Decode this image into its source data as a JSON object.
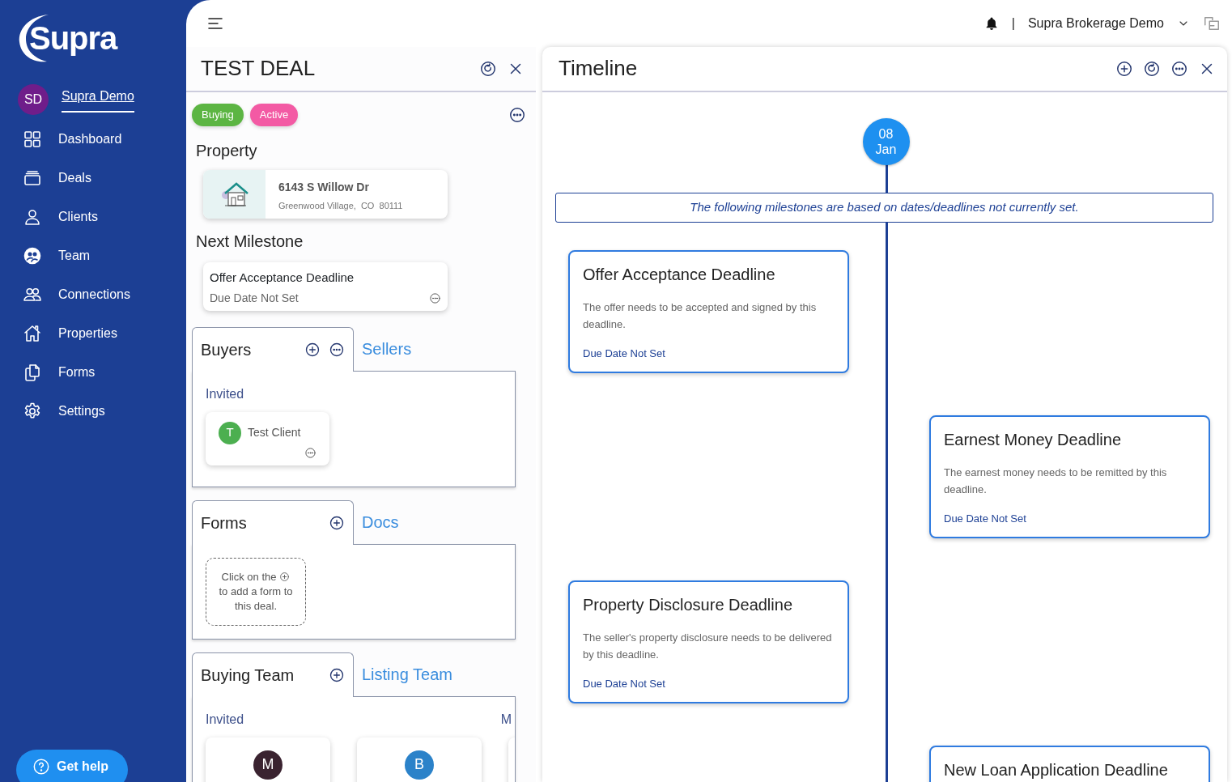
{
  "logo": {
    "text": "Supra"
  },
  "user": {
    "initials": "SD",
    "name": "Supra Demo"
  },
  "nav": [
    {
      "label": "Dashboard"
    },
    {
      "label": "Deals"
    },
    {
      "label": "Clients"
    },
    {
      "label": "Team"
    },
    {
      "label": "Connections"
    },
    {
      "label": "Properties"
    },
    {
      "label": "Forms"
    },
    {
      "label": "Settings"
    }
  ],
  "help": {
    "label": "Get help"
  },
  "topbar": {
    "separator": "|",
    "org": "Supra Brokerage Demo"
  },
  "deal": {
    "title": "TEST DEAL",
    "tags": [
      {
        "label": "Buying",
        "color": "#5cb543"
      },
      {
        "label": "Active",
        "color": "#f35aa4"
      }
    ],
    "property_heading": "Property",
    "property": {
      "street": "6143 S Willow Dr",
      "city": "Greenwood Village,  CO  80111"
    },
    "milestone_heading": "Next Milestone",
    "next_milestone": {
      "title": "Offer Acceptance Deadline",
      "due": "Due Date Not Set"
    },
    "sections": [
      {
        "tabs": [
          {
            "label": "Buyers",
            "selected": true
          },
          {
            "label": "Sellers",
            "selected": false
          }
        ],
        "group": "Invited",
        "people": [
          {
            "initial": "T",
            "name": "Test Client",
            "color": "#4caf50"
          }
        ]
      },
      {
        "tabs": [
          {
            "label": "Forms",
            "selected": true
          },
          {
            "label": "Docs",
            "selected": false
          }
        ],
        "empty": {
          "before": "Click on the",
          "after": "to add a form to this deal."
        }
      },
      {
        "tabs": [
          {
            "label": "Buying Team",
            "selected": true
          },
          {
            "label": "Listing Team",
            "selected": false
          }
        ],
        "group": "Invited",
        "group_2": "M",
        "people": [
          {
            "initial": "M",
            "color": "#3a2330"
          },
          {
            "initial": "B",
            "color": "#2b82c9"
          }
        ]
      }
    ]
  },
  "timeline": {
    "title": "Timeline",
    "date": {
      "day": "08",
      "month": "Jan"
    },
    "notice": "The following milestones are based on dates/deadlines not currently set.",
    "milestones": [
      {
        "title": "Offer Acceptance Deadline",
        "description": "The offer needs to be accepted and signed by this deadline.",
        "due": "Due Date Not Set"
      },
      {
        "title": "Earnest Money Deadline",
        "description": "The earnest money needs to be remitted by this deadline.",
        "due": "Due Date Not Set"
      },
      {
        "title": "Property Disclosure Deadline",
        "description": "The seller's property disclosure needs to be delivered by this deadline.",
        "due": "Due Date Not Set"
      },
      {
        "title": "New Loan Application Deadline"
      }
    ]
  }
}
